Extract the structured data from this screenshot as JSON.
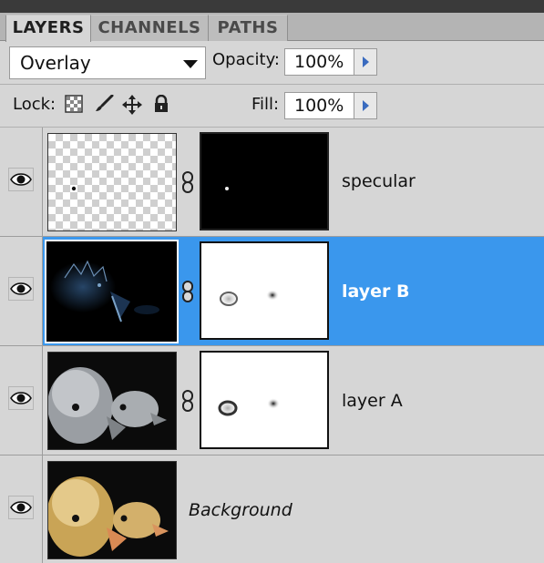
{
  "tabs": [
    {
      "label": "LAYERS"
    },
    {
      "label": "CHANNELS"
    },
    {
      "label": "PATHS"
    }
  ],
  "blend_mode": "Overlay",
  "opacity": {
    "label": "Opacity:",
    "value": "100%"
  },
  "lock": {
    "label": "Lock:"
  },
  "fill": {
    "label": "Fill:",
    "value": "100%"
  },
  "layers": [
    {
      "name": "specular",
      "selected": false,
      "italic": false
    },
    {
      "name": "layer B",
      "selected": true,
      "italic": false
    },
    {
      "name": "layer A",
      "selected": false,
      "italic": false
    },
    {
      "name": "Background",
      "selected": false,
      "italic": true
    }
  ],
  "icons": {
    "visibility": "eye-icon",
    "link": "chain-link-icon",
    "lock_transparency": "checkerboard-icon",
    "lock_image": "brush-icon",
    "lock_position": "move-icon",
    "lock_all": "padlock-icon",
    "dropdown": "chevron-down-icon",
    "stepper": "triangle-right-icon"
  },
  "colors": {
    "selection": "#3a97ed",
    "panel": "#d6d6d6",
    "tabbar": "#b4b4b4"
  }
}
